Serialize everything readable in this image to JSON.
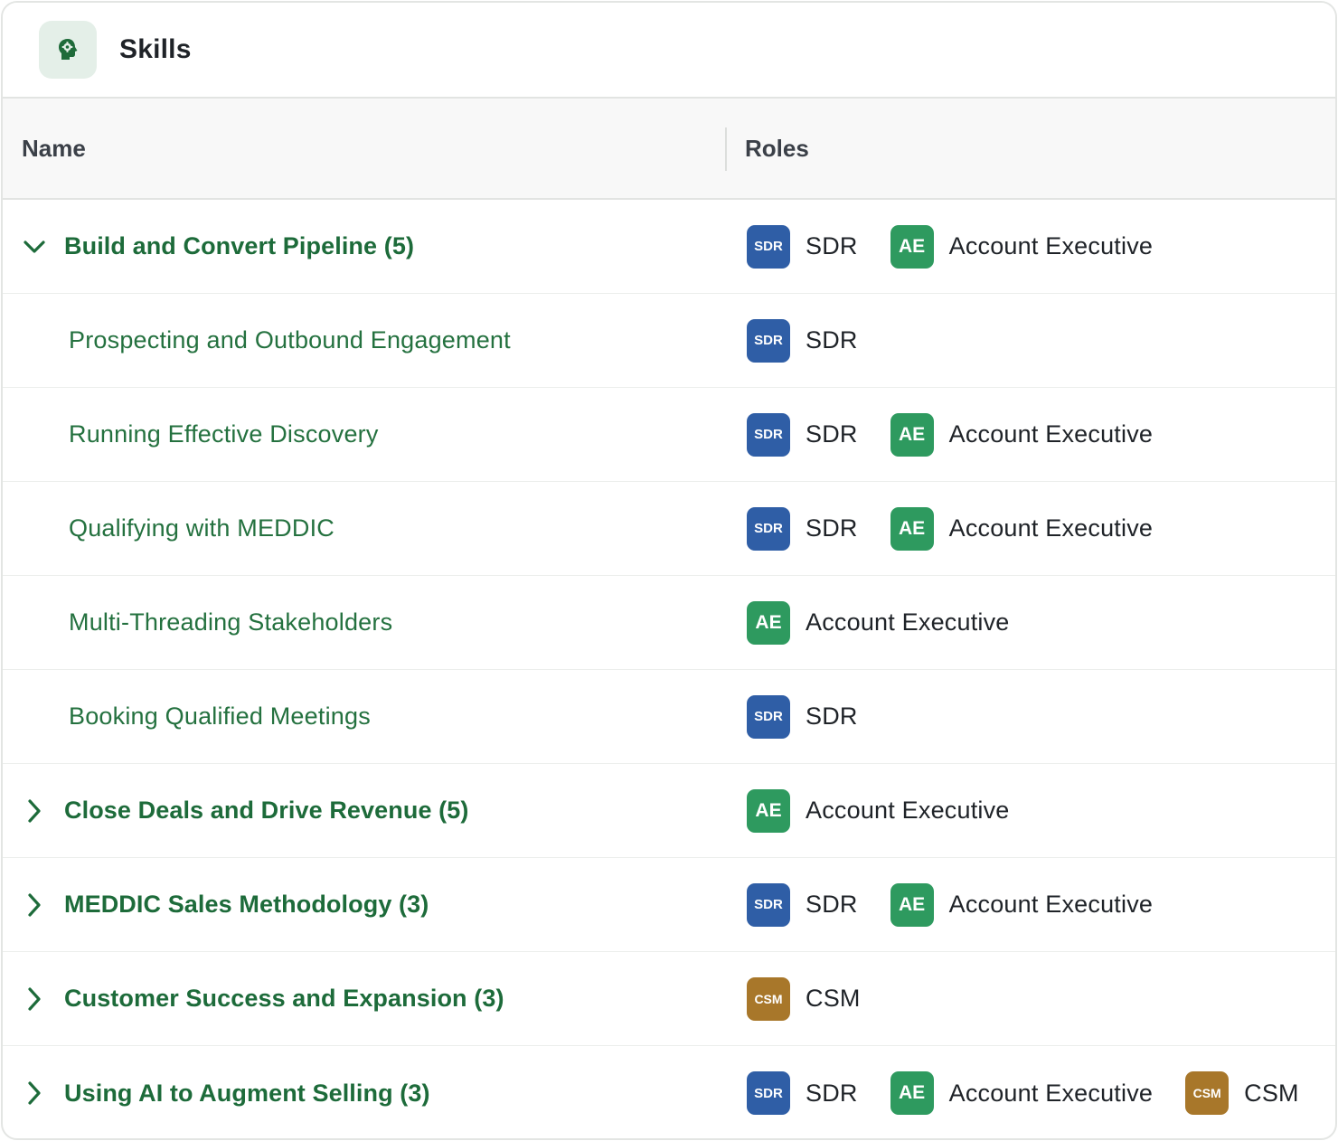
{
  "header": {
    "title": "Skills",
    "icon": "brain-gear-icon"
  },
  "columns": {
    "name": "Name",
    "roles": "Roles"
  },
  "role_defs": {
    "SDR": {
      "badge": "SDR",
      "label": "SDR",
      "color": "#2f5ea6"
    },
    "AE": {
      "badge": "AE",
      "label": "Account Executive",
      "color": "#2e9a5f"
    },
    "CSM": {
      "badge": "CSM",
      "label": "CSM",
      "color": "#a8772a"
    }
  },
  "rows": [
    {
      "type": "group",
      "expanded": true,
      "name": "Build and Convert Pipeline (5)",
      "roles": [
        "SDR",
        "AE"
      ]
    },
    {
      "type": "child",
      "name": "Prospecting and Outbound Engagement",
      "roles": [
        "SDR"
      ]
    },
    {
      "type": "child",
      "name": "Running Effective Discovery",
      "roles": [
        "SDR",
        "AE"
      ]
    },
    {
      "type": "child",
      "name": "Qualifying with MEDDIC",
      "roles": [
        "SDR",
        "AE"
      ]
    },
    {
      "type": "child",
      "name": "Multi-Threading Stakeholders",
      "roles": [
        "AE"
      ]
    },
    {
      "type": "child",
      "name": "Booking Qualified Meetings",
      "roles": [
        "SDR"
      ]
    },
    {
      "type": "group",
      "expanded": false,
      "name": "Close Deals and Drive Revenue (5)",
      "roles": [
        "AE"
      ]
    },
    {
      "type": "group",
      "expanded": false,
      "name": "MEDDIC Sales Methodology (3)",
      "roles": [
        "SDR",
        "AE"
      ]
    },
    {
      "type": "group",
      "expanded": false,
      "name": "Customer Success and Expansion (3)",
      "roles": [
        "CSM"
      ]
    },
    {
      "type": "group",
      "expanded": false,
      "name": "Using AI to Augment Selling (3)",
      "roles": [
        "SDR",
        "AE",
        "CSM"
      ]
    }
  ]
}
